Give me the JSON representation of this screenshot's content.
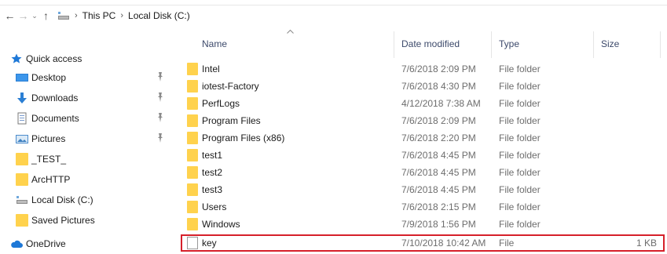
{
  "address_bar": {
    "back_glyph": "←",
    "forward_glyph": "→",
    "recent_glyph": "⌄",
    "up_glyph": "↑",
    "separator_glyph": "›",
    "crumbs": [
      "This PC",
      "Local Disk (C:)"
    ]
  },
  "nav_pane": {
    "quick_access": {
      "label": "Quick access",
      "icon": "star-icon"
    },
    "items": [
      {
        "label": "Desktop",
        "icon": "desktop-icon",
        "pinned": true
      },
      {
        "label": "Downloads",
        "icon": "download-icon",
        "pinned": true
      },
      {
        "label": "Documents",
        "icon": "documents-icon",
        "pinned": true
      },
      {
        "label": "Pictures",
        "icon": "pictures-icon",
        "pinned": true
      },
      {
        "label": "_TEST_",
        "icon": "folder-icon",
        "pinned": false
      },
      {
        "label": "ArcHTTP",
        "icon": "folder-icon",
        "pinned": false
      },
      {
        "label": "Local Disk (C:)",
        "icon": "drive-icon",
        "pinned": false
      },
      {
        "label": "Saved Pictures",
        "icon": "folder-icon",
        "pinned": false
      }
    ],
    "onedrive": {
      "label": "OneDrive",
      "icon": "cloud-icon"
    }
  },
  "file_list": {
    "columns": {
      "name": "Name",
      "date": "Date modified",
      "type": "Type",
      "size": "Size"
    },
    "rows": [
      {
        "name": "Intel",
        "date": "7/6/2018 2:09 PM",
        "type": "File folder",
        "size": "",
        "icon": "folder-icon"
      },
      {
        "name": "iotest-Factory",
        "date": "7/6/2018 4:30 PM",
        "type": "File folder",
        "size": "",
        "icon": "folder-icon"
      },
      {
        "name": "PerfLogs",
        "date": "4/12/2018 7:38 AM",
        "type": "File folder",
        "size": "",
        "icon": "folder-icon"
      },
      {
        "name": "Program Files",
        "date": "7/6/2018 2:09 PM",
        "type": "File folder",
        "size": "",
        "icon": "folder-icon"
      },
      {
        "name": "Program Files (x86)",
        "date": "7/6/2018 2:20 PM",
        "type": "File folder",
        "size": "",
        "icon": "folder-icon"
      },
      {
        "name": "test1",
        "date": "7/6/2018 4:45 PM",
        "type": "File folder",
        "size": "",
        "icon": "folder-icon"
      },
      {
        "name": "test2",
        "date": "7/6/2018 4:45 PM",
        "type": "File folder",
        "size": "",
        "icon": "folder-icon"
      },
      {
        "name": "test3",
        "date": "7/6/2018 4:45 PM",
        "type": "File folder",
        "size": "",
        "icon": "folder-icon"
      },
      {
        "name": "Users",
        "date": "7/6/2018 2:15 PM",
        "type": "File folder",
        "size": "",
        "icon": "folder-icon"
      },
      {
        "name": "Windows",
        "date": "7/9/2018 1:56 PM",
        "type": "File folder",
        "size": "",
        "icon": "folder-icon"
      },
      {
        "name": "key",
        "date": "7/10/2018 10:42 AM",
        "type": "File",
        "size": "1 KB",
        "icon": "file-icon",
        "highlighted": true
      }
    ]
  },
  "colors": {
    "highlight_border": "#d6202a",
    "folder_yellow": "#ffd24d",
    "quick_access_star": "#1e78d7",
    "onedrive_blue": "#1e78d7",
    "header_text": "#3d4a6b"
  }
}
